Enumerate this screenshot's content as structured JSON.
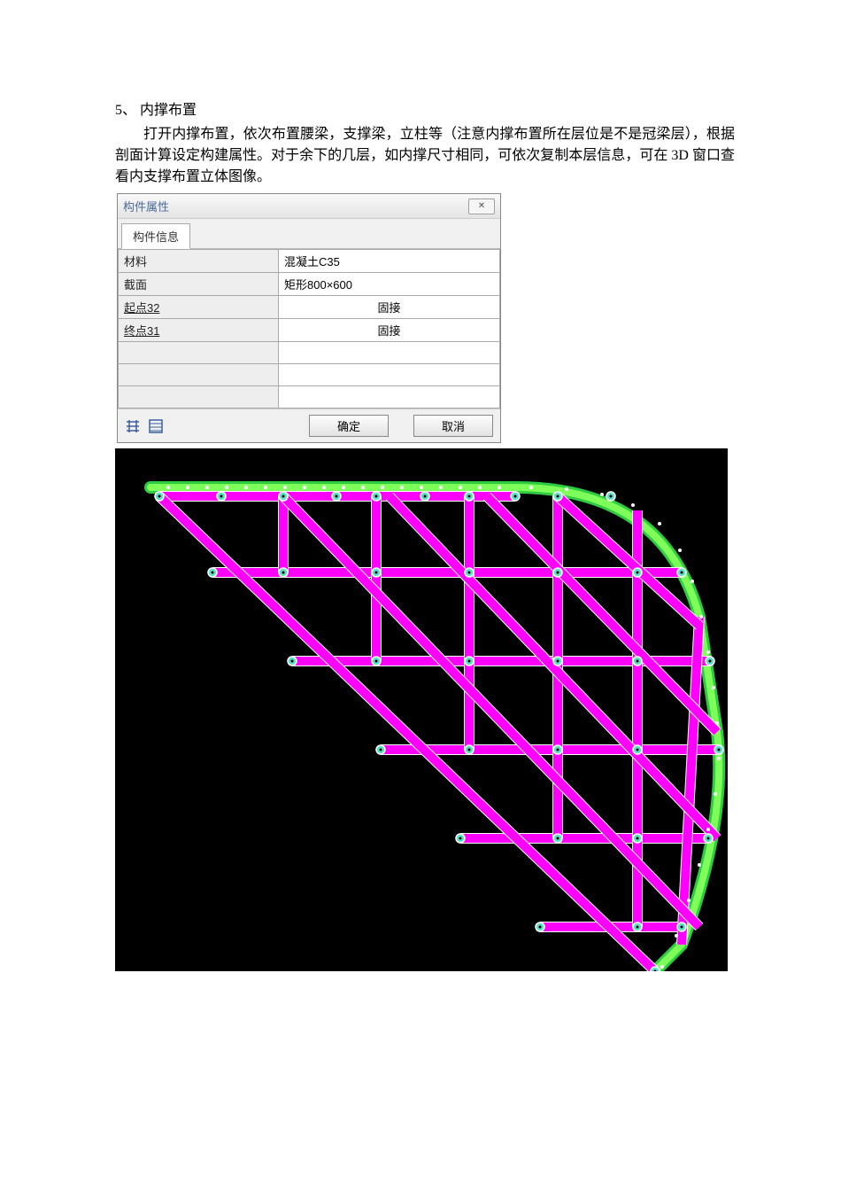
{
  "heading": "5、 内撑布置",
  "paragraph": "打开内撑布置，依次布置腰梁，支撑梁，立柱等（注意内撑布置所在层位是不是冠梁层），根据剖面计算设定构建属性。对于余下的几层，如内撑尺寸相同，可依次复制本层信息，可在 3D 窗口查看内支撑布置立体图像。",
  "dialog": {
    "title": "构件属性",
    "close_glyph": "✕",
    "tab": "构件信息",
    "rows": [
      {
        "key": "材料",
        "val": "混凝土C35",
        "align": "left"
      },
      {
        "key": "截面",
        "val": "矩形800×600",
        "align": "left"
      },
      {
        "key": "起点32",
        "val": "固接",
        "align": "center",
        "underline": true
      },
      {
        "key": "终点31",
        "val": "固接",
        "align": "center",
        "underline": true
      },
      {
        "key": "",
        "val": ""
      },
      {
        "key": "",
        "val": ""
      },
      {
        "key": "",
        "val": ""
      }
    ],
    "ok": "确定",
    "cancel": "取消"
  },
  "viewport": {
    "desc": "structural-bracing-plan-view"
  }
}
